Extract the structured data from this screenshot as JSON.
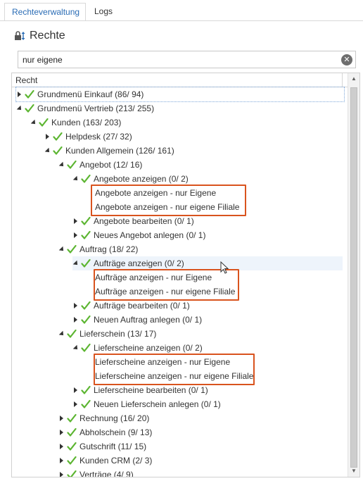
{
  "tabs": [
    {
      "label": "Rechteverwaltung",
      "active": true
    },
    {
      "label": "Logs",
      "active": false
    }
  ],
  "heading": {
    "title": "Rechte",
    "icon": "lock-sort-icon"
  },
  "search": {
    "value": "nur eigene",
    "clear_icon": "clear-icon"
  },
  "tree": {
    "column_header": "Recht",
    "rows": [
      {
        "label": "Grundmenü Einkauf (86/ 94)",
        "expander": "collapsed",
        "checked": true
      },
      {
        "label": "Grundmenü Vertrieb (213/ 255)",
        "expander": "expanded",
        "checked": true
      },
      {
        "label": "Kunden (163/ 203)",
        "expander": "expanded",
        "checked": true
      },
      {
        "label": "Helpdesk (27/ 32)",
        "expander": "collapsed",
        "checked": true
      },
      {
        "label": "Kunden Allgemein (126/ 161)",
        "expander": "expanded",
        "checked": true
      },
      {
        "label": "Angebot (12/ 16)",
        "expander": "expanded",
        "checked": true
      },
      {
        "label": "Angebote anzeigen (0/ 2)",
        "expander": "expanded",
        "checked": true
      },
      {
        "label": "Angebote anzeigen - nur Eigene",
        "leaf": true
      },
      {
        "label": "Angebote anzeigen - nur eigene Filiale",
        "leaf": true
      },
      {
        "label": "Angebote bearbeiten (0/ 1)",
        "expander": "collapsed",
        "checked": true
      },
      {
        "label": "Neues Angebot anlegen (0/ 1)",
        "expander": "collapsed",
        "checked": true
      },
      {
        "label": "Auftrag (18/ 22)",
        "expander": "expanded",
        "checked": true
      },
      {
        "label": "Aufträge anzeigen (0/ 2)",
        "expander": "expanded",
        "checked": true
      },
      {
        "label": "Aufträge anzeigen - nur Eigene",
        "leaf": true
      },
      {
        "label": "Aufträge anzeigen - nur eigene Filiale",
        "leaf": true
      },
      {
        "label": "Aufträge bearbeiten (0/ 1)",
        "expander": "collapsed",
        "checked": true
      },
      {
        "label": "Neuen Auftrag anlegen (0/ 1)",
        "expander": "collapsed",
        "checked": true
      },
      {
        "label": "Lieferschein (13/ 17)",
        "expander": "expanded",
        "checked": true
      },
      {
        "label": "Lieferscheine anzeigen (0/ 2)",
        "expander": "expanded",
        "checked": true
      },
      {
        "label": "Lieferscheine anzeigen - nur Eigene",
        "leaf": true
      },
      {
        "label": "Lieferscheine anzeigen - nur eigene Filiale",
        "leaf": true
      },
      {
        "label": "Lieferscheine bearbeiten (0/ 1)",
        "expander": "collapsed",
        "checked": true
      },
      {
        "label": "Neuen Lieferschein anlegen (0/ 1)",
        "expander": "collapsed",
        "checked": true
      },
      {
        "label": "Rechnung (16/ 20)",
        "expander": "collapsed",
        "checked": true
      },
      {
        "label": "Abholschein (9/ 13)",
        "expander": "collapsed",
        "checked": true
      },
      {
        "label": "Gutschrift (11/ 15)",
        "expander": "collapsed",
        "checked": true
      },
      {
        "label": "Kunden CRM (2/ 3)",
        "expander": "collapsed",
        "checked": true
      },
      {
        "label": "Verträge (4/ 9)",
        "expander": "collapsed",
        "checked": true
      }
    ]
  },
  "colors": {
    "accent": "#2a6cb5",
    "check": "#5cb531",
    "highlight_box": "#d9531e"
  }
}
